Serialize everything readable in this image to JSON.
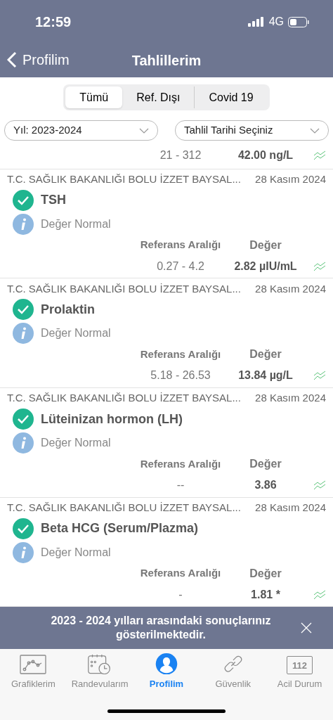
{
  "status_bar": {
    "time": "12:59",
    "network": "4G"
  },
  "nav": {
    "back_label": "Profilim",
    "title": "Tahlillerim"
  },
  "segments": [
    {
      "label": "Tümü",
      "selected": true
    },
    {
      "label": "Ref. Dışı",
      "selected": false
    },
    {
      "label": "Covid 19",
      "selected": false
    }
  ],
  "filters": [
    {
      "value": "Yıl: 2023-2024"
    },
    {
      "value": "Tahlil Tarihi Seçiniz"
    }
  ],
  "partial_row": {
    "reference": "21 - 312",
    "value": "42.00 ng/L"
  },
  "results": [
    {
      "hospital": "T.C. SAĞLIK BAKANLIĞI BOLU İZZET BAYSAL...",
      "date": "28 Kasım 2024",
      "test": "TSH",
      "status": "Değer Normal",
      "reference_header": "Referans Aralığı",
      "value_header": "Değer",
      "reference": "0.27 - 4.2",
      "value": "2.82 µIU/mL"
    },
    {
      "hospital": "T.C. SAĞLIK BAKANLIĞI BOLU İZZET BAYSAL...",
      "date": "28 Kasım 2024",
      "test": "Prolaktin",
      "status": "Değer Normal",
      "reference_header": "Referans Aralığı",
      "value_header": "Değer",
      "reference": "5.18 - 26.53",
      "value": "13.84 µg/L"
    },
    {
      "hospital": "T.C. SAĞLIK BAKANLIĞI BOLU İZZET BAYSAL...",
      "date": "28 Kasım 2024",
      "test": "Lüteinizan hormon (LH)",
      "status": "Değer Normal",
      "reference_header": "Referans Aralığı",
      "value_header": "Değer",
      "reference": "--",
      "value": "3.86"
    },
    {
      "hospital": "T.C. SAĞLIK BAKANLIĞI BOLU İZZET BAYSAL...",
      "date": "28 Kasım 2024",
      "test": "Beta HCG (Serum/Plazma)",
      "status": "Değer Normal",
      "reference_header": "Referans Aralığı",
      "value_header": "Değer",
      "reference": "-",
      "value": "1.81 *"
    }
  ],
  "banner": {
    "message": "2023 - 2024 yılları arasındaki sonuçlarınız gösterilmektedir."
  },
  "tab_bar": [
    {
      "kind": "chart",
      "label": "Grafiklerim",
      "selected": false
    },
    {
      "kind": "calendar",
      "label": "Randevularım",
      "selected": false
    },
    {
      "kind": "profile",
      "label": "Profilim",
      "selected": true
    },
    {
      "kind": "link",
      "label": "Güvenlik",
      "selected": false
    },
    {
      "kind": "emergency",
      "label": "Acil Durum",
      "icon_text": "112",
      "selected": false
    }
  ]
}
